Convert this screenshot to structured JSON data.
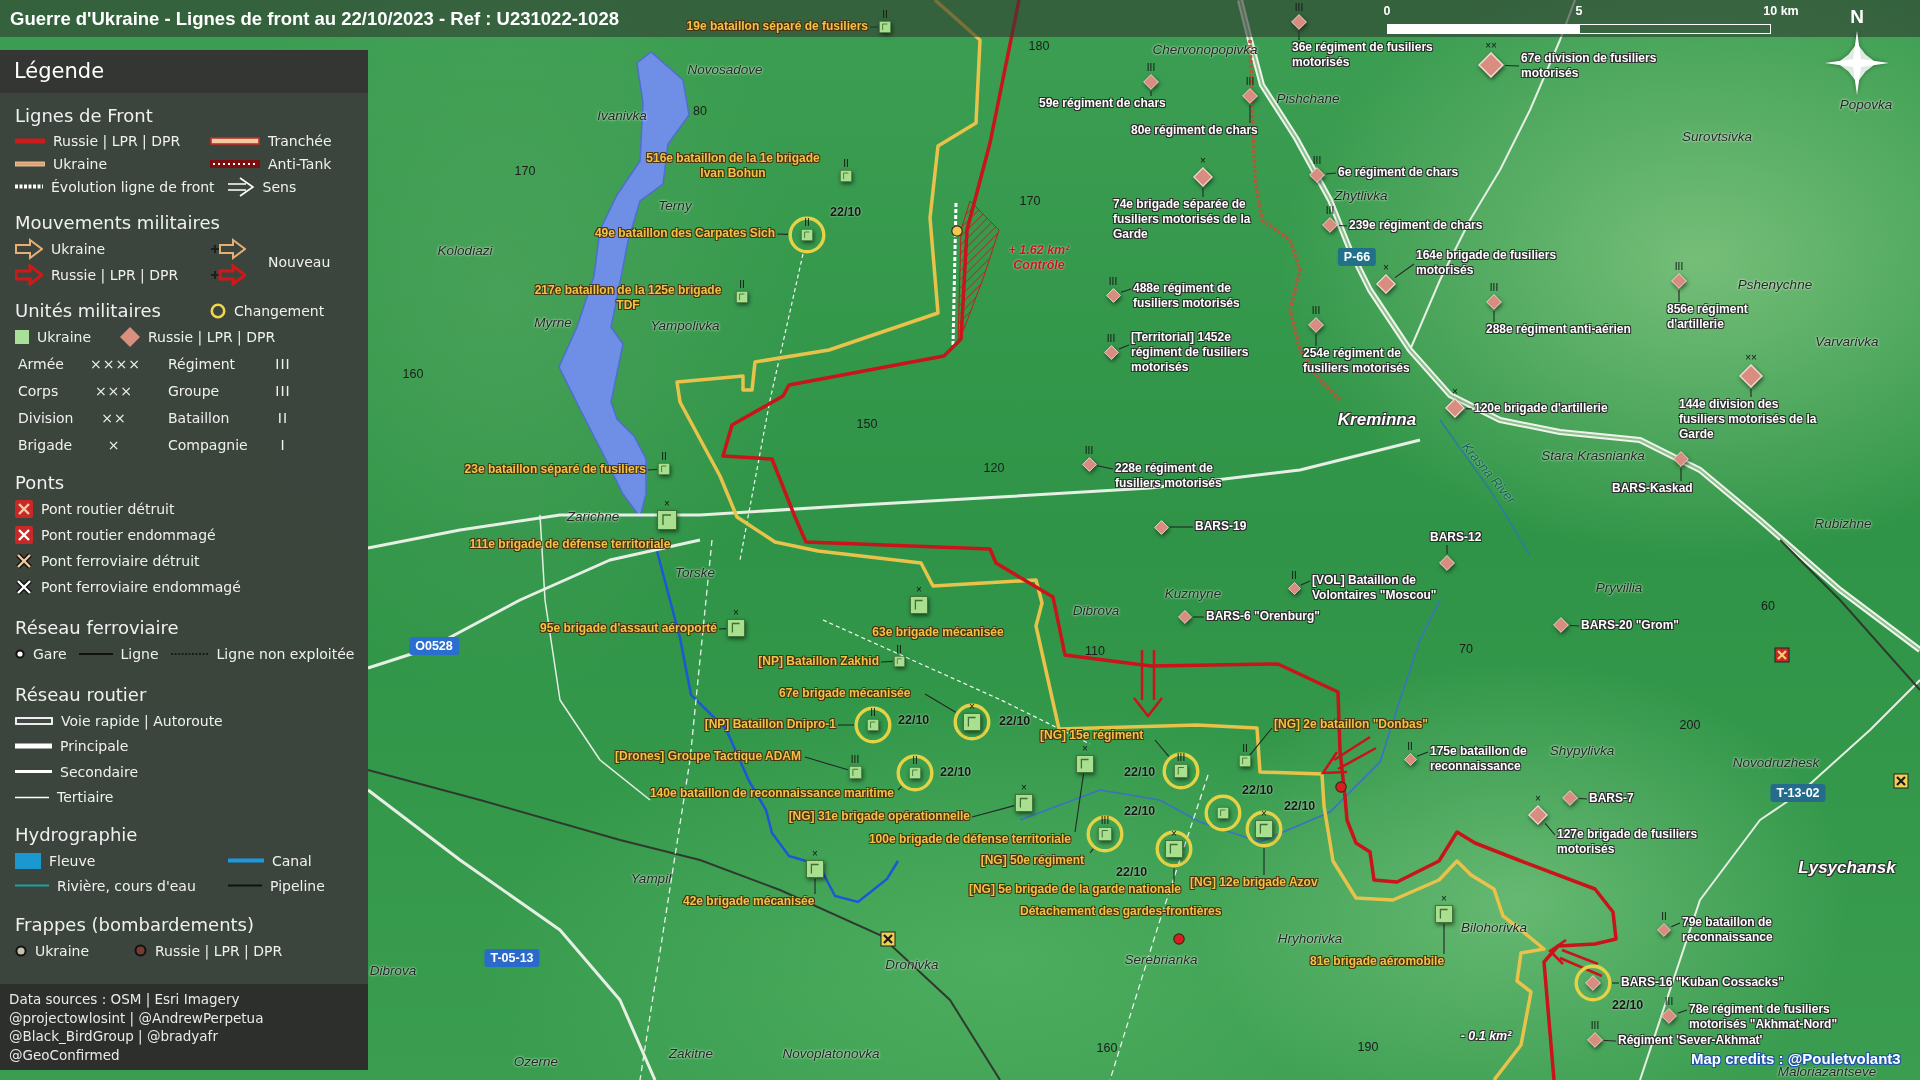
{
  "title": "Guerre d'Ukraine - Lignes de front au 22/10/2023 - Ref : U231022-1028",
  "scale_bar": {
    "ticks": [
      "0",
      "5",
      "10 km"
    ]
  },
  "compass": {
    "label": "N"
  },
  "legend": {
    "title": "Légende",
    "sections": [
      {
        "heading": "Lignes de Front",
        "rows": [
          [
            {
              "kind": "front-russia",
              "label": "Russie | LPR | DPR"
            },
            {
              "kind": "trench",
              "label": "Tranchée"
            }
          ],
          [
            {
              "kind": "front-ukraine",
              "label": "Ukraine"
            },
            {
              "kind": "anti-tank",
              "label": "Anti-Tank"
            }
          ],
          [
            {
              "kind": "evolution",
              "label": "Évolution ligne de front"
            },
            {
              "kind": "direction",
              "label": "Sens"
            }
          ]
        ]
      },
      {
        "heading": "Mouvements militaires",
        "rows": [
          [
            {
              "kind": "move-ukraine",
              "label": "Ukraine"
            },
            {
              "kind": "new-move-ukraine"
            }
          ],
          [
            {
              "kind": "move-russia",
              "label": "Russie | LPR | DPR"
            },
            {
              "kind": "new-move-russia"
            }
          ]
        ],
        "side_label": "Nouveau"
      },
      {
        "heading": "Unités militaires",
        "heading_item": {
          "kind": "change",
          "label": "Changement"
        },
        "rows": [
          [
            {
              "kind": "unit-ukraine",
              "label": "Ukraine"
            },
            {
              "kind": "unit-russia",
              "label": "Russie | LPR | DPR"
            }
          ]
        ],
        "echelons": [
          [
            {
              "name": "Armée",
              "symbol": "××××"
            },
            {
              "name": "Régiment",
              "symbol": "III"
            }
          ],
          [
            {
              "name": "Corps",
              "symbol": "×××"
            },
            {
              "name": "Groupe",
              "symbol": "III"
            }
          ],
          [
            {
              "name": "Division",
              "symbol": "××"
            },
            {
              "name": "Bataillon",
              "symbol": "II"
            }
          ],
          [
            {
              "name": "Brigade",
              "symbol": "×"
            },
            {
              "name": "Compagnie",
              "symbol": "I"
            }
          ]
        ]
      },
      {
        "heading": "Ponts",
        "rows": [
          [
            {
              "kind": "bridge-road-destroyed",
              "label": "Pont routier détruit"
            }
          ],
          [
            {
              "kind": "bridge-road-damaged",
              "label": "Pont routier endommagé"
            }
          ],
          [
            {
              "kind": "bridge-rail-destroyed",
              "label": "Pont ferroviaire détruit"
            }
          ],
          [
            {
              "kind": "bridge-rail-damaged",
              "label": "Pont ferroviaire endommagé"
            }
          ]
        ]
      },
      {
        "heading": "Réseau ferroviaire",
        "rows": [
          [
            {
              "kind": "station",
              "label": "Gare"
            },
            {
              "kind": "rail",
              "label": "Ligne"
            },
            {
              "kind": "rail-unused",
              "label": "Ligne non exploitée"
            }
          ]
        ]
      },
      {
        "heading": "Réseau routier",
        "rows": [
          [
            {
              "kind": "road-express",
              "label": "Voie rapide | Autoroute"
            }
          ],
          [
            {
              "kind": "road-main",
              "label": "Principale"
            }
          ],
          [
            {
              "kind": "road-secondary",
              "label": "Secondaire"
            }
          ],
          [
            {
              "kind": "road-tertiary",
              "label": "Tertiaire"
            }
          ]
        ]
      },
      {
        "heading": "Hydrographie",
        "rows": [
          [
            {
              "kind": "river-area",
              "label": "Fleuve"
            },
            {
              "kind": "canal",
              "label": "Canal"
            }
          ],
          [
            {
              "kind": "stream",
              "label": "Rivière, cours d'eau"
            },
            {
              "kind": "pipeline",
              "label": "Pipeline"
            }
          ]
        ]
      },
      {
        "heading": "Frappes (bombardements)",
        "rows": [
          [
            {
              "kind": "strike-ukraine",
              "label": "Ukraine"
            },
            {
              "kind": "strike-russia",
              "label": "Russie | LPR | DPR"
            }
          ]
        ]
      }
    ],
    "sources": [
      "Data sources : OSM | Esri Imagery",
      "@projectowlosint | @AndrewPerpetua",
      "@Black_BirdGroup | @bradyafr",
      "@GeoConfirmed"
    ]
  },
  "ukraine_units": [
    {
      "name": "19e bataillon séparé de fusiliers",
      "echelon": "II",
      "changed": false
    },
    {
      "name": "516e bataillon de la 1e brigade\nIvan Bohun",
      "echelon": "II",
      "changed": false
    },
    {
      "name": "49e bataillon des Carpates Sich",
      "echelon": "II",
      "changed": true,
      "date": "22/10"
    },
    {
      "name": "217e bataillon de la 125e brigade\nTDF",
      "echelon": "II",
      "changed": false
    },
    {
      "name": "23e bataillon séparé de fusiliers",
      "echelon": "II",
      "changed": false
    },
    {
      "name": "111e brigade de défense territoriale",
      "echelon": "×",
      "changed": false
    },
    {
      "name": "95e brigade d'assaut aéroporté",
      "echelon": "×",
      "changed": false
    },
    {
      "name": "63e brigade mécanisée",
      "echelon": "×",
      "changed": false
    },
    {
      "name": "[NP] Bataillon Zakhid",
      "echelon": "II",
      "changed": false
    },
    {
      "name": "67e brigade mécanisée",
      "echelon": "×",
      "changed": true,
      "date": "22/10"
    },
    {
      "name": "[NP] Bataillon Dnipro-1",
      "echelon": "II",
      "changed": true,
      "date": "22/10"
    },
    {
      "name": "[Drones] Groupe Tactique ADAM",
      "echelon": "III",
      "changed": false
    },
    {
      "name": "140e bataillon de reconnaissance maritime",
      "echelon": "II",
      "changed": true,
      "date": "22/10"
    },
    {
      "name": "[NG] 31e brigade opérationnelle",
      "echelon": "×",
      "changed": false
    },
    {
      "name": "100e brigade de défense territoriale",
      "echelon": "×",
      "changed": false
    },
    {
      "name": "[NG] 15e régiment",
      "echelon": "III",
      "changed": true,
      "date": "22/10"
    },
    {
      "name": "[NG] 50e régiment",
      "echelon": "III",
      "changed": true,
      "date": "22/10"
    },
    {
      "name": "[NG] 5e brigade de la garde nationale",
      "echelon": "×",
      "changed": true,
      "date": "22/10"
    },
    {
      "name": "[NG] 2e bataillon \"Donbas\"",
      "echelon": "II",
      "changed": false
    },
    {
      "name": "[NG] 12e brigade Azov",
      "echelon": "×",
      "changed": true,
      "date": "22/10"
    },
    {
      "name": "Détachement des gardes-frontières",
      "changed": true,
      "date": "22/10"
    },
    {
      "name": "42e brigade mécanisée",
      "echelon": "×",
      "changed": false
    },
    {
      "name": "81e brigade aéromobile",
      "echelon": "×",
      "changed": false
    }
  ],
  "russia_units": [
    {
      "name": "36e régiment de fusiliers\nmotorisés",
      "echelon": "III",
      "changed": false
    },
    {
      "name": "67e division de fusiliers\nmotorisés",
      "echelon": "××",
      "changed": false
    },
    {
      "name": "59e régiment de chars",
      "echelon": "III",
      "changed": false
    },
    {
      "name": "80e régiment de chars",
      "echelon": "III",
      "changed": false
    },
    {
      "name": "74e brigade séparée de\nfusiliers motorisés de la\nGarde",
      "echelon": "×",
      "changed": false
    },
    {
      "name": "6e régiment de chars",
      "echelon": "III",
      "changed": false
    },
    {
      "name": "239e régiment de chars",
      "echelon": "III",
      "changed": false
    },
    {
      "name": "164e brigade de fusiliers\nmotorisés",
      "echelon": "×",
      "changed": false
    },
    {
      "name": "488e régiment de\nfusiliers motorisés",
      "echelon": "III",
      "changed": false
    },
    {
      "name": "288e régiment anti-aérien",
      "echelon": "III",
      "changed": false
    },
    {
      "name": "856e régiment\nd'artillerie",
      "echelon": "III",
      "changed": false
    },
    {
      "name": "[Territorial] 1452e\nrégiment de fusiliers\nmotorisés",
      "echelon": "III",
      "changed": false
    },
    {
      "name": "254e régiment de\nfusiliers motorisés",
      "echelon": "III",
      "changed": false
    },
    {
      "name": "120e brigade d'artillerie",
      "echelon": "×",
      "changed": false
    },
    {
      "name": "144e division des\nfusiliers motorisés de la\nGarde",
      "echelon": "××",
      "changed": false
    },
    {
      "name": "228e régiment de\nfusiliers motorisés",
      "echelon": "III",
      "changed": false
    },
    {
      "name": "BARS-Kaskad",
      "changed": false
    },
    {
      "name": "BARS-19",
      "changed": false
    },
    {
      "name": "BARS-12",
      "changed": false
    },
    {
      "name": "[VOL] Bataillon de\nVolontaires \"Moscou\"",
      "echelon": "II",
      "changed": false
    },
    {
      "name": "BARS-6 \"Orenburg\"",
      "changed": false
    },
    {
      "name": "BARS-20 \"Grom\"",
      "changed": false
    },
    {
      "name": "175e bataillon de\nreconnaissance",
      "echelon": "II",
      "changed": false
    },
    {
      "name": "BARS-7",
      "changed": false
    },
    {
      "name": "127e brigade de fusiliers\nmotorisés",
      "echelon": "×",
      "changed": false
    },
    {
      "name": "79e bataillon de\nreconnaissance",
      "echelon": "II",
      "changed": false
    },
    {
      "name": "BARS-16 \"Kuban Cossacks\"",
      "changed": true,
      "date": "22/10"
    },
    {
      "name": "78e régiment de fusiliers\nmotorisés \"Akhmat-Nord\"",
      "echelon": "III",
      "changed": false
    },
    {
      "name": "Régiment 'Sever-Akhmat'",
      "echelon": "III",
      "changed": false
    }
  ],
  "places": [
    {
      "name": "Novosadove",
      "kind": "village"
    },
    {
      "name": "Ivanivka",
      "kind": "village"
    },
    {
      "name": "Chervonopopivka",
      "kind": "village"
    },
    {
      "name": "Popovka",
      "kind": "village"
    },
    {
      "name": "Pishchane",
      "kind": "village"
    },
    {
      "name": "Surovtsivka",
      "kind": "village"
    },
    {
      "name": "Terny",
      "kind": "village"
    },
    {
      "name": "Zhytlivka",
      "kind": "village"
    },
    {
      "name": "Kolodiazi",
      "kind": "village"
    },
    {
      "name": "Pshenychne",
      "kind": "village"
    },
    {
      "name": "Myrne",
      "kind": "village"
    },
    {
      "name": "Yampolivka",
      "kind": "village"
    },
    {
      "name": "Varvarivka",
      "kind": "village"
    },
    {
      "name": "Kreminna",
      "kind": "town"
    },
    {
      "name": "Stara Krasnianka",
      "kind": "village"
    },
    {
      "name": "Krasna River",
      "kind": "river"
    },
    {
      "name": "Zarichne",
      "kind": "village"
    },
    {
      "name": "Rubizhne",
      "kind": "village"
    },
    {
      "name": "Torske",
      "kind": "village"
    },
    {
      "name": "Pryvillia",
      "kind": "village"
    },
    {
      "name": "Kuzmyne",
      "kind": "village"
    },
    {
      "name": "Dibrova",
      "kind": "village"
    },
    {
      "name": "Shypylivka",
      "kind": "village"
    },
    {
      "name": "Novodruzhesk",
      "kind": "village"
    },
    {
      "name": "Lysychansk",
      "kind": "town"
    },
    {
      "name": "Yampil",
      "kind": "village"
    },
    {
      "name": "Bilohorivka",
      "kind": "village"
    },
    {
      "name": "Hryhorivka",
      "kind": "village"
    },
    {
      "name": "Serebrianka",
      "kind": "village"
    },
    {
      "name": "Dronivka",
      "kind": "village"
    },
    {
      "name": "Dibrova",
      "kind": "village"
    },
    {
      "name": "Zakitne",
      "kind": "village"
    },
    {
      "name": "Novoplatonovka",
      "kind": "village"
    },
    {
      "name": "Ozerne",
      "kind": "village"
    },
    {
      "name": "Maloriazantseve",
      "kind": "village"
    }
  ],
  "elevations": [
    "180",
    "80",
    "170",
    "170",
    "160",
    "150",
    "120",
    "110",
    "70",
    "60",
    "200",
    "160",
    "190"
  ],
  "road_badges": [
    {
      "text": "P-66",
      "color": "#22708a"
    },
    {
      "text": "O0528",
      "color": "#2a6fd0"
    },
    {
      "text": "T-05-13",
      "color": "#2a6acb"
    },
    {
      "text": "T-13-02",
      "color": "#256c8c"
    }
  ],
  "area_changes": [
    {
      "kind": "gain",
      "amount": "+ 1.62 km²",
      "status": "Contrôle"
    },
    {
      "kind": "loss",
      "amount": "- 0.1 km²"
    }
  ],
  "strikes": [
    {
      "color": "#f2c94c"
    },
    {
      "color": "#d81e1e"
    },
    {
      "color": "#d81e1e"
    }
  ],
  "bridges": [
    {
      "kind": "rail-destroyed"
    },
    {
      "kind": "road-destroyed"
    },
    {
      "kind": "rail-destroyed"
    }
  ],
  "credits": "Map credits : @Pouletvolant3"
}
